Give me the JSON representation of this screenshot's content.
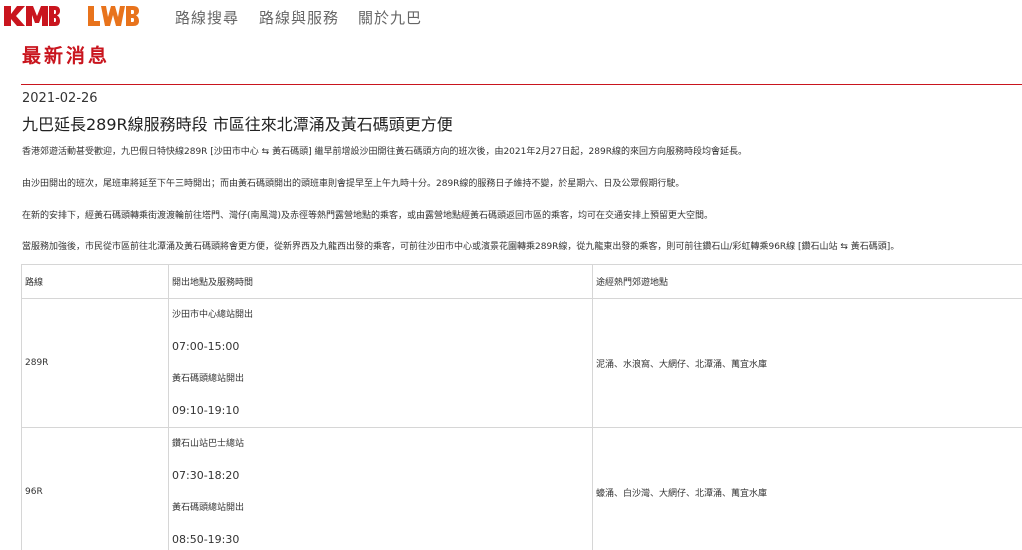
{
  "brand": {
    "kmb": "KMB",
    "lwb": "LWB",
    "accent": "#c9151e",
    "lwb_color": "#e8731c"
  },
  "nav": {
    "items": [
      "路線搜尋",
      "路線與服務",
      "關於九巴"
    ]
  },
  "page": {
    "title": "最新消息"
  },
  "article": {
    "date": "2021-02-26",
    "headline": "九巴延長289R線服務時段 市區往來北潭涌及黃石碼頭更方便",
    "paragraphs": [
      "香港郊遊活動甚受歡迎，九巴假日特快線289R [沙田市中心 ⇆ 黃石碼頭] 繼早前增設沙田開往黃石碼頭方向的班次後，由2021年2月27日起，289R線的來回方向服務時段均會延長。",
      "由沙田開出的班次，尾班車將延至下午三時開出；而由黃石碼頭開出的頭班車則會提早至上午九時十分。289R線的服務日子維持不變，於星期六、日及公眾假期行駛。",
      "在新的安排下，經黃石碼頭轉乘街渡渡輪前往塔門、灣仔(南風灣)及赤徑等熱門露營地點的乘客，或由露營地點經黃石碼頭返回市區的乘客，均可在交通安排上預留更大空間。",
      "當服務加強後，市民從市區前往北潭涌及黃石碼頭將會更方便，從新界西及九龍西出發的乘客，可前往沙田市中心或濱景花園轉乘289R線，從九龍東出發的乘客，則可前往鑽石山/彩虹轉乘96R線 [鑽石山站 ⇆ 黃石碼頭]。"
    ]
  },
  "table": {
    "headers": [
      "路線",
      "開出地點及服務時間",
      "途經熱門郊遊地點"
    ],
    "rows": [
      {
        "route": "289R",
        "services": [
          "沙田市中心總站開出",
          "07:00-15:00",
          "黃石碼頭總站開出",
          "09:10-19:10"
        ],
        "spots": "泥涌、水浪窩、大網仔、北潭涌、萬宜水庫"
      },
      {
        "route": "96R",
        "services": [
          "鑽石山站巴士總站",
          "07:30-18:20",
          "黃石碼頭總站開出",
          "08:50-19:30"
        ],
        "spots": "蠔涌、白沙灣、大網仔、北潭涌、萬宜水庫"
      }
    ]
  }
}
